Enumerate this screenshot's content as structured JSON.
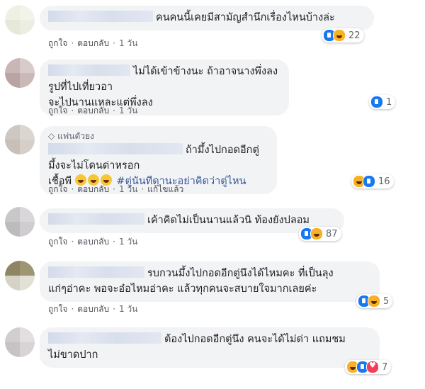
{
  "action_labels": {
    "like": "ถูกใจ",
    "reply": "ตอบกลับ",
    "edit": "แก้ไขแล้ว",
    "separator": "·"
  },
  "comments": [
    {
      "text": "คนคนนี้เคยมีสามัญสำนึกเรื่องไหนบ้างล่ะ",
      "time": "1 วัน",
      "reactions": {
        "icons": [
          "like-icon",
          "haha-icon"
        ],
        "count": "22"
      }
    },
    {
      "line1": "ไม่ได้เข้าข้างนะ ถ้าอาจนางพึ่งลงรูปที่ไปเที่ยวอา",
      "line2": "จะไปนานแหละแต่พึ่งลง",
      "time": "1 วัน",
      "reactions": {
        "icons": [
          "like-icon"
        ],
        "count": "1"
      }
    },
    {
      "badge": "แฟนตัวยง",
      "line1": "ถ้ามึ้งไปกอดอีกตู่ มึ้งจะไม่โดนด่าหรอก",
      "line2_text": "เชื้อพี",
      "line2_tag": "#ตู่นันทีดานะอย่าคิดว่าตู่ไหน",
      "time": "1 วัน",
      "edited": true,
      "reactions": {
        "icons": [
          "haha-icon",
          "like-icon"
        ],
        "count": "16"
      }
    },
    {
      "text": "เค้าคิดไม่เป็นนานแล้วนิ ท้องยังปลอม",
      "time": "1 วัน",
      "reactions": {
        "icons": [
          "like-icon",
          "haha-icon"
        ],
        "count": "87"
      }
    },
    {
      "line1": "รบกวนมึ้งไปกอดอีกตู่นึงได้ไหมคะ ที่เป็นลุง",
      "line2": "แก่ๆอ่าคะ พอจะอ๋อไหมอ่าคะ แล้วทุกคนจะสบายใจมากเลยค่ะ",
      "time": "1 วัน",
      "reactions": {
        "icons": [
          "like-icon",
          "haha-icon"
        ],
        "count": "5"
      }
    },
    {
      "line1": "ต้องไปกอดอีกตู่นึง คนจะได้ไม่ด่า แถมชม",
      "line2": "ไม่ขาดปาก",
      "time": "1 วัน",
      "reactions": {
        "icons": [
          "haha-icon",
          "like-icon",
          "love-icon"
        ],
        "count": "7"
      }
    }
  ]
}
